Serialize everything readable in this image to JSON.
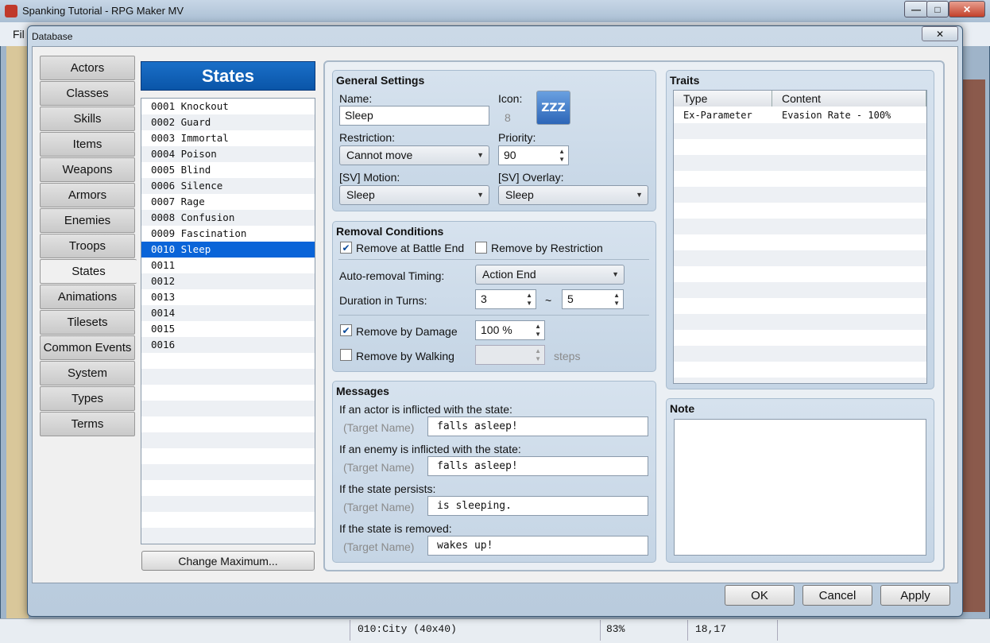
{
  "app": {
    "title": "Spanking Tutorial - RPG Maker MV",
    "menu_partial": "Fil",
    "status": {
      "map": "010:City (40x40)",
      "zoom": "83%",
      "coords": "18,17"
    }
  },
  "dialog": {
    "title": "Database",
    "close_glyph": "✕",
    "tabs": [
      "Actors",
      "Classes",
      "Skills",
      "Items",
      "Weapons",
      "Armors",
      "Enemies",
      "Troops",
      "States",
      "Animations",
      "Tilesets",
      "Common Events",
      "System",
      "Types",
      "Terms"
    ],
    "active_tab": "States"
  },
  "states_list": {
    "header": "States",
    "items": [
      "0001 Knockout",
      "0002 Guard",
      "0003 Immortal",
      "0004 Poison",
      "0005 Blind",
      "0006 Silence",
      "0007 Rage",
      "0008 Confusion",
      "0009 Fascination",
      "0010 Sleep",
      "0011",
      "0012",
      "0013",
      "0014",
      "0015",
      "0016"
    ],
    "selected_index": 9,
    "change_max_label": "Change Maximum..."
  },
  "general": {
    "title": "General Settings",
    "name_label": "Name:",
    "name_value": "Sleep",
    "icon_label": "Icon:",
    "icon_index": "8",
    "icon_glyph": "ZZZ",
    "icon_name": "sleep-zzz-icon",
    "restriction_label": "Restriction:",
    "restriction_value": "Cannot move",
    "priority_label": "Priority:",
    "priority_value": "90",
    "sv_motion_label": "[SV] Motion:",
    "sv_motion_value": "Sleep",
    "sv_overlay_label": "[SV] Overlay:",
    "sv_overlay_value": "Sleep"
  },
  "removal": {
    "title": "Removal Conditions",
    "battle_end_label": "Remove at Battle End",
    "battle_end_checked": true,
    "by_restriction_label": "Remove by Restriction",
    "by_restriction_checked": false,
    "timing_label": "Auto-removal Timing:",
    "timing_value": "Action End",
    "duration_label": "Duration in Turns:",
    "duration_min": "3",
    "duration_tilde": "~",
    "duration_max": "5",
    "by_damage_label": "Remove by Damage",
    "by_damage_checked": true,
    "by_damage_value": "100 %",
    "by_walking_label": "Remove by Walking",
    "by_walking_checked": false,
    "steps_label": "steps"
  },
  "messages": {
    "title": "Messages",
    "target_placeholder": "(Target Name)",
    "rows": [
      {
        "label": "If an actor is inflicted with the state:",
        "value": "falls asleep!"
      },
      {
        "label": "If an enemy is inflicted with the state:",
        "value": "falls asleep!"
      },
      {
        "label": "If the state persists:",
        "value": "is sleeping."
      },
      {
        "label": "If the state is removed:",
        "value": "wakes up!"
      }
    ]
  },
  "traits": {
    "title": "Traits",
    "columns": [
      "Type",
      "Content"
    ],
    "rows": [
      {
        "type": "Ex-Parameter",
        "content": "Evasion Rate - 100%"
      }
    ]
  },
  "note": {
    "title": "Note",
    "value": ""
  },
  "buttons": {
    "ok": "OK",
    "cancel": "Cancel",
    "apply": "Apply"
  },
  "colors": {
    "accent": "#0a64d8",
    "header": "#0a55a8"
  }
}
